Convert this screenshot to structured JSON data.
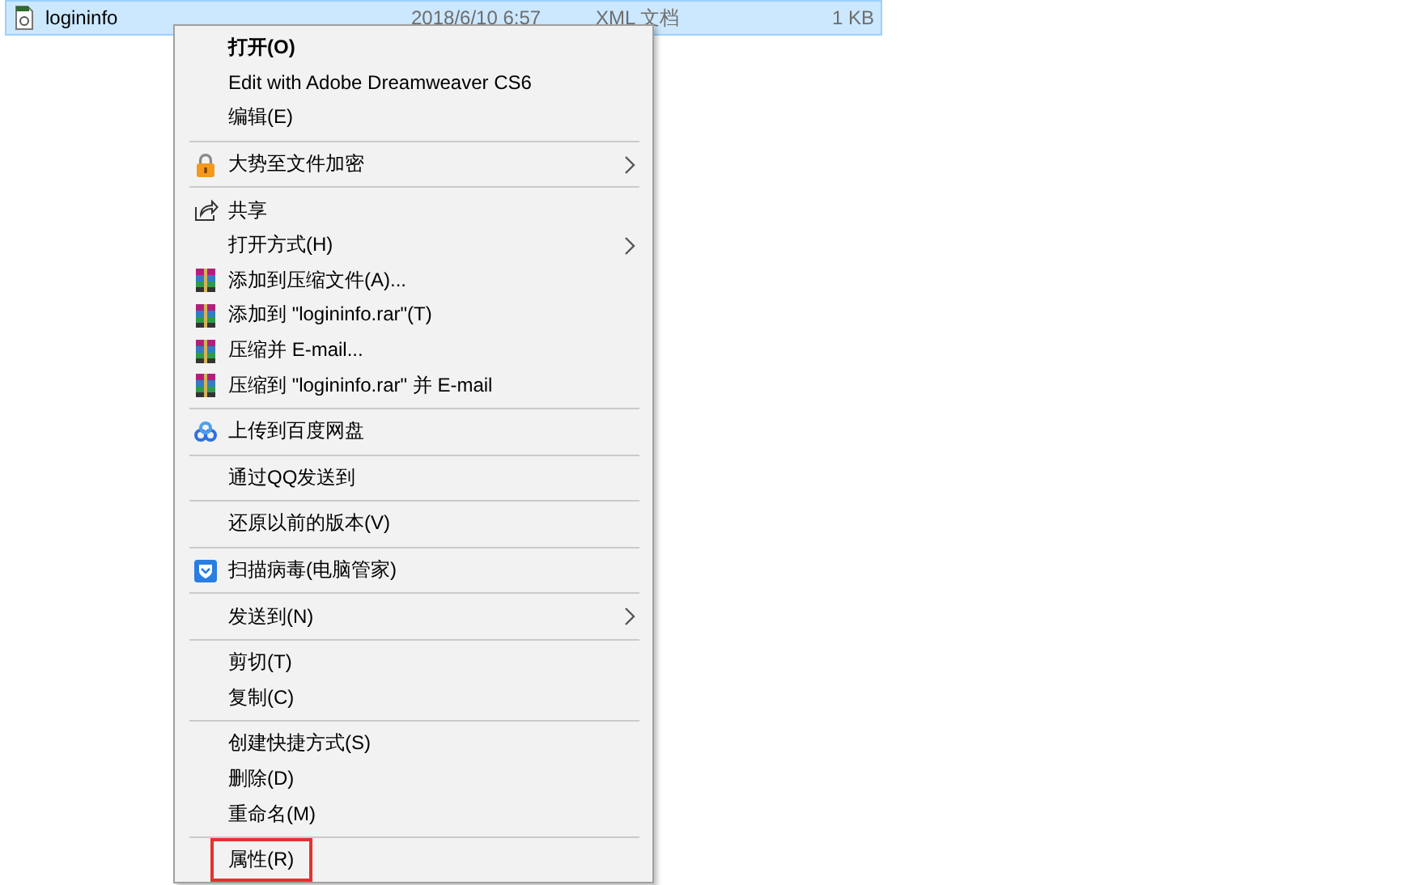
{
  "file_row": {
    "name": "logininfo",
    "date": "2018/6/10 6:57",
    "type": "XML 文档",
    "size": "1 KB",
    "selected": true
  },
  "context_menu": {
    "items": [
      {
        "kind": "text",
        "label": "打开(O)",
        "default": true
      },
      {
        "kind": "text",
        "label": "Edit with Adobe Dreamweaver CS6"
      },
      {
        "kind": "text",
        "label": "编辑(E)"
      },
      {
        "kind": "separator"
      },
      {
        "kind": "lock",
        "label": "大势至文件加密",
        "submenu": true
      },
      {
        "kind": "separator"
      },
      {
        "kind": "share",
        "label": "共享"
      },
      {
        "kind": "text",
        "label": "打开方式(H)",
        "submenu": true
      },
      {
        "kind": "archive",
        "label": "添加到压缩文件(A)..."
      },
      {
        "kind": "archive",
        "label": "添加到 \"logininfo.rar\"(T)"
      },
      {
        "kind": "archive",
        "label": "压缩并 E-mail..."
      },
      {
        "kind": "archive",
        "label": "压缩到 \"logininfo.rar\" 并 E-mail"
      },
      {
        "kind": "separator"
      },
      {
        "kind": "cloud",
        "label": "上传到百度网盘"
      },
      {
        "kind": "separator"
      },
      {
        "kind": "text",
        "label": "通过QQ发送到"
      },
      {
        "kind": "separator"
      },
      {
        "kind": "text",
        "label": "还原以前的版本(V)"
      },
      {
        "kind": "separator"
      },
      {
        "kind": "shield",
        "label": "扫描病毒(电脑管家)"
      },
      {
        "kind": "separator"
      },
      {
        "kind": "text",
        "label": "发送到(N)",
        "submenu": true
      },
      {
        "kind": "separator"
      },
      {
        "kind": "text",
        "label": "剪切(T)"
      },
      {
        "kind": "text",
        "label": "复制(C)"
      },
      {
        "kind": "separator"
      },
      {
        "kind": "text",
        "label": "创建快捷方式(S)"
      },
      {
        "kind": "text",
        "label": "删除(D)"
      },
      {
        "kind": "text",
        "label": "重命名(M)"
      },
      {
        "kind": "separator"
      },
      {
        "kind": "text",
        "label": "属性(R)",
        "highlighted": true
      }
    ]
  }
}
